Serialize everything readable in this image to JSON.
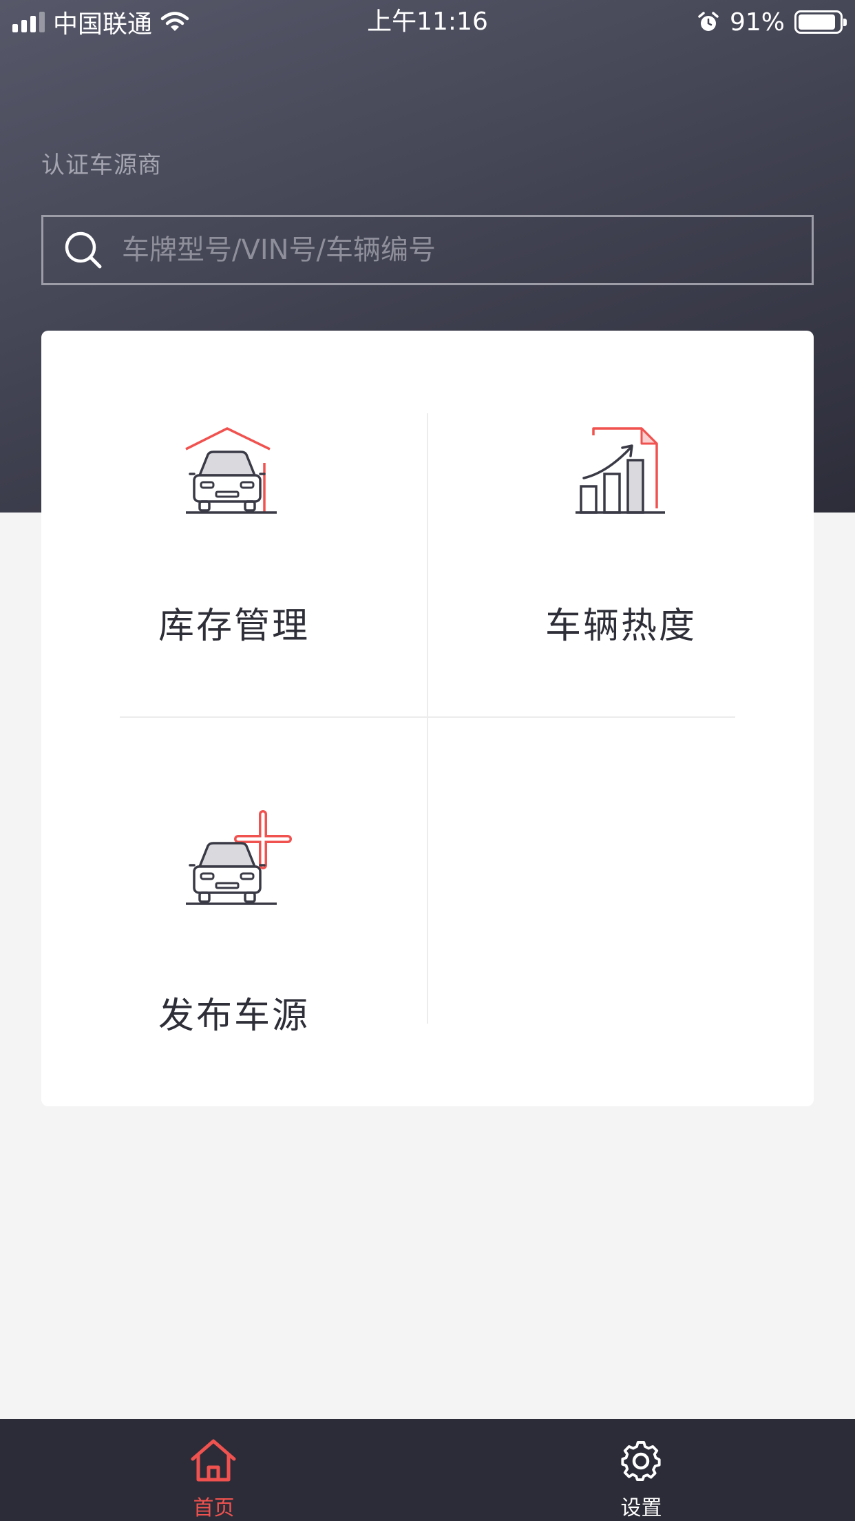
{
  "status_bar": {
    "carrier": "中国联通",
    "time": "上午11:16",
    "battery": "91%",
    "battery_level": 0.91
  },
  "header": {
    "subtitle": "认证车源商"
  },
  "search": {
    "placeholder": "车牌型号/VIN号/车辆编号",
    "icon": "search-icon"
  },
  "menu": {
    "items": [
      {
        "label": "库存管理",
        "icon": "garage-car-icon"
      },
      {
        "label": "车辆热度",
        "icon": "trend-chart-icon"
      },
      {
        "label": "发布车源",
        "icon": "car-add-icon"
      }
    ]
  },
  "tab_bar": {
    "tabs": [
      {
        "label": "首页",
        "icon": "home-icon",
        "active": true
      },
      {
        "label": "设置",
        "icon": "gear-icon",
        "active": false
      }
    ]
  },
  "colors": {
    "accent": "#f0524f",
    "header_top": "#565869",
    "header_bottom": "#2d2d3a",
    "tab_bar_bg": "#2c2c38",
    "icon_stroke": "#3a3a46"
  }
}
